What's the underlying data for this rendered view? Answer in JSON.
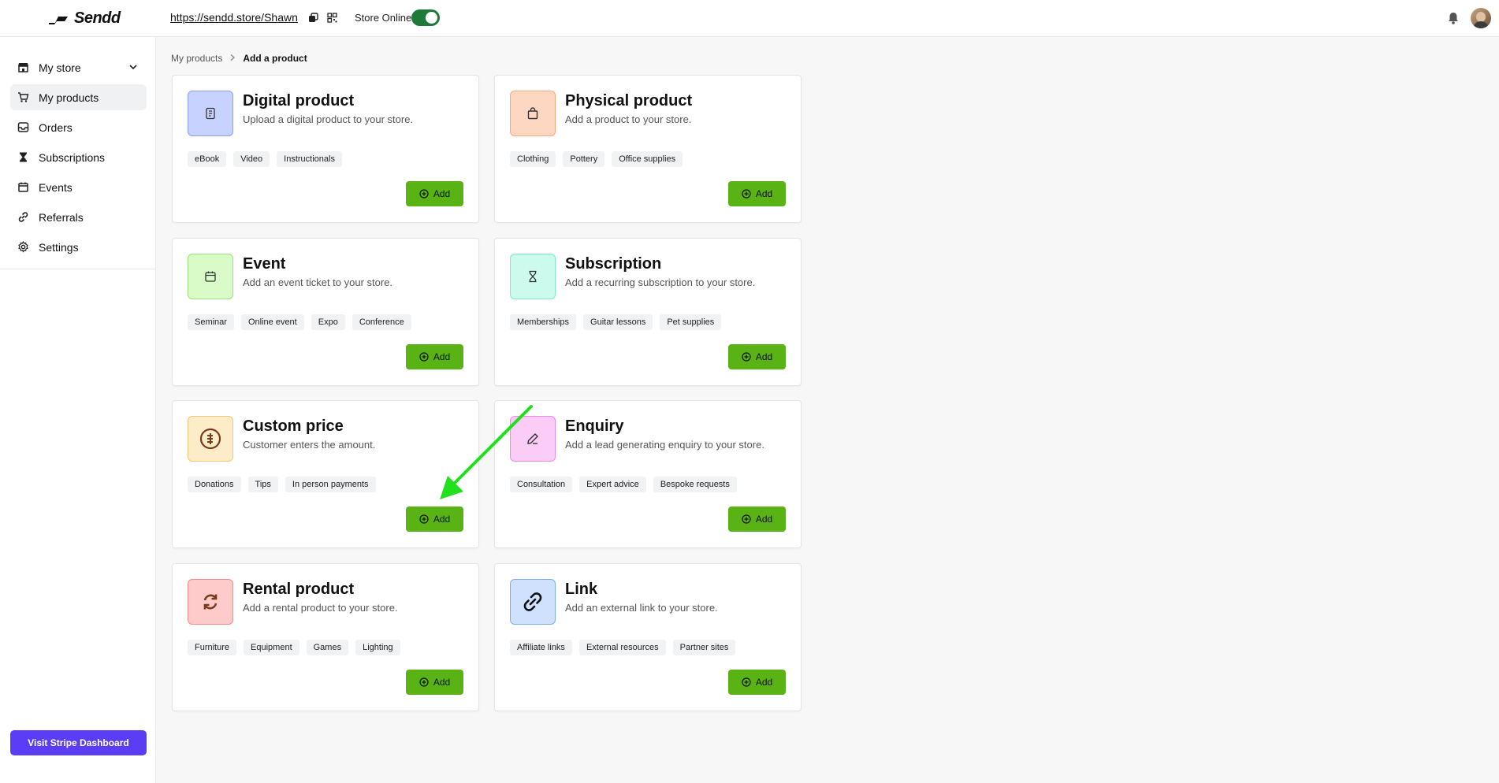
{
  "brand": {
    "name": "Sendd"
  },
  "header": {
    "store_url": "https://sendd.store/Shawn",
    "store_online_label": "Store Online",
    "store_online": true
  },
  "sidebar": {
    "items": [
      {
        "label": "My store",
        "icon": "store-icon"
      },
      {
        "label": "My products",
        "icon": "cart-icon"
      },
      {
        "label": "Orders",
        "icon": "inbox-icon"
      },
      {
        "label": "Subscriptions",
        "icon": "hourglass-icon"
      },
      {
        "label": "Events",
        "icon": "calendar-icon"
      },
      {
        "label": "Referrals",
        "icon": "link-icon"
      },
      {
        "label": "Settings",
        "icon": "gear-icon"
      }
    ],
    "stripe_button": "Visit Stripe Dashboard"
  },
  "breadcrumb": {
    "parent": "My products",
    "current": "Add a product"
  },
  "cards": [
    {
      "title": "Digital product",
      "desc": "Upload a digital product to your store.",
      "tags": [
        "eBook",
        "Video",
        "Instructionals"
      ],
      "add": "Add",
      "icon_bg": "#c7d2fe",
      "icon_border": "#8aa0f5"
    },
    {
      "title": "Physical product",
      "desc": "Add a product to your store.",
      "tags": [
        "Clothing",
        "Pottery",
        "Office supplies"
      ],
      "add": "Add",
      "icon_bg": "#fed7c3",
      "icon_border": "#f4a87d"
    },
    {
      "title": "Event",
      "desc": "Add an event ticket to your store.",
      "tags": [
        "Seminar",
        "Online event",
        "Expo",
        "Conference"
      ],
      "add": "Add",
      "icon_bg": "#d9fbc8",
      "icon_border": "#9de07b"
    },
    {
      "title": "Subscription",
      "desc": "Add a recurring subscription to your store.",
      "tags": [
        "Memberships",
        "Guitar lessons",
        "Pet supplies"
      ],
      "add": "Add",
      "icon_bg": "#ccfbee",
      "icon_border": "#7ee8c9"
    },
    {
      "title": "Custom price",
      "desc": "Customer enters the amount.",
      "tags": [
        "Donations",
        "Tips",
        "In person payments"
      ],
      "add": "Add",
      "icon_bg": "#fdecc8",
      "icon_border": "#f5c67a"
    },
    {
      "title": "Enquiry",
      "desc": "Add a lead generating enquiry to your store.",
      "tags": [
        "Consultation",
        "Expert advice",
        "Bespoke requests"
      ],
      "add": "Add",
      "icon_bg": "#fbcdf6",
      "icon_border": "#ef8ce3"
    },
    {
      "title": "Rental product",
      "desc": "Add a rental product to your store.",
      "tags": [
        "Furniture",
        "Equipment",
        "Games",
        "Lighting"
      ],
      "add": "Add",
      "icon_bg": "#fecaca",
      "icon_border": "#f58a8a"
    },
    {
      "title": "Link",
      "desc": "Add an external link to your store.",
      "tags": [
        "Affiliate links",
        "External resources",
        "Partner sites"
      ],
      "add": "Add",
      "icon_bg": "#cfe1fd",
      "icon_border": "#7faaf0"
    }
  ],
  "colors": {
    "accent_green": "#59b315",
    "stripe_purple": "#5b3df5",
    "toggle_green": "#1f7a3a",
    "annotation_arrow": "#22e01e"
  }
}
